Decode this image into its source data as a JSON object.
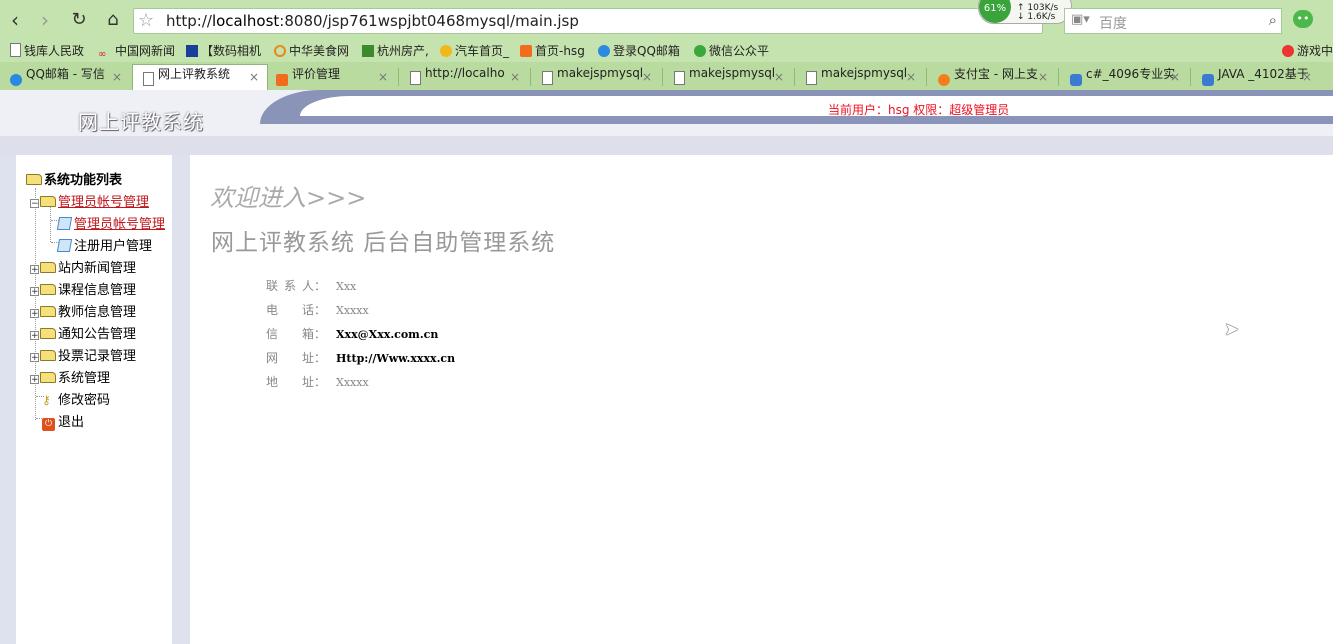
{
  "browser": {
    "url_prefix": "http://",
    "url_host": "localhost",
    "url_rest": ":8080/jsp761wspjbt0468mysql/main.jsp",
    "search_placeholder": "百度",
    "net": {
      "percent": "61%",
      "up": "103K/s",
      "down": "1.6K/s"
    }
  },
  "bookmarks": [
    "钱库人民政",
    "中国网新闻",
    "【数码相机",
    "中华美食网",
    "杭州房产,",
    "汽车首页_",
    "首页-hsg",
    "登录QQ邮箱",
    "微信公众平",
    "游戏中"
  ],
  "tabs": [
    "QQ邮箱 - 写信",
    "网上评教系统",
    "评价管理",
    "http://localho",
    "makejspmysql",
    "makejspmysql",
    "makejspmysql",
    "支付宝 - 网上支",
    "c#_4096专业实",
    "JAVA _4102基于"
  ],
  "header": {
    "site_title": "网上评教系统",
    "user_info": "当前用户：hsg   权限：超级管理员"
  },
  "sidebar": {
    "root": "系统功能列表",
    "items": [
      {
        "label": "管理员帐号管理"
      },
      {
        "label": "管理员帐号管理"
      },
      {
        "label": "注册用户管理"
      },
      {
        "label": "站内新闻管理"
      },
      {
        "label": "课程信息管理"
      },
      {
        "label": "教师信息管理"
      },
      {
        "label": "通知公告管理"
      },
      {
        "label": "投票记录管理"
      },
      {
        "label": "系统管理"
      },
      {
        "label": "修改密码"
      },
      {
        "label": "退出"
      }
    ]
  },
  "main": {
    "welcome": "欢迎进入>>>",
    "title": "网上评教系统 后台自助管理系统",
    "info": [
      {
        "label": "联系人",
        "value": "Xxx"
      },
      {
        "label": "电 话",
        "value": "Xxxxx"
      },
      {
        "label": "信 箱",
        "value": "Xxx@Xxx.com.cn"
      },
      {
        "label": "网 址",
        "value": "Http://Www.xxxx.cn"
      },
      {
        "label": "地 址",
        "value": "Xxxxx"
      }
    ]
  },
  "colors": {
    "accent_red": "#c0161b",
    "browser_green": "#c5e3ae"
  }
}
